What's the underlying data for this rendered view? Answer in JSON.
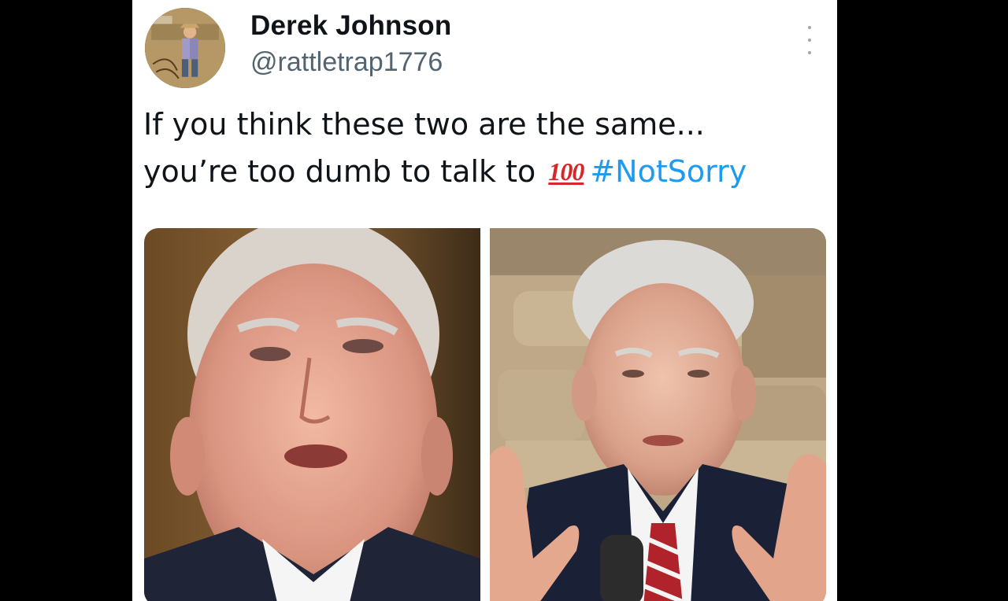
{
  "tweet": {
    "author": {
      "name": "Derek Johnson",
      "handle": "@rattletrap1776"
    },
    "text": {
      "line1": "If you think these two are the same...",
      "line2_prefix": "you’re too dumb to talk to",
      "emoji": "100",
      "hashtag": "#NotSorry"
    },
    "media": [
      {
        "icon": "photo-left"
      },
      {
        "icon": "photo-right"
      }
    ]
  },
  "colors": {
    "hashtag": "#1d9bf0",
    "name": "#0f1419",
    "handle": "#536471",
    "emoji": "#d8262b"
  }
}
